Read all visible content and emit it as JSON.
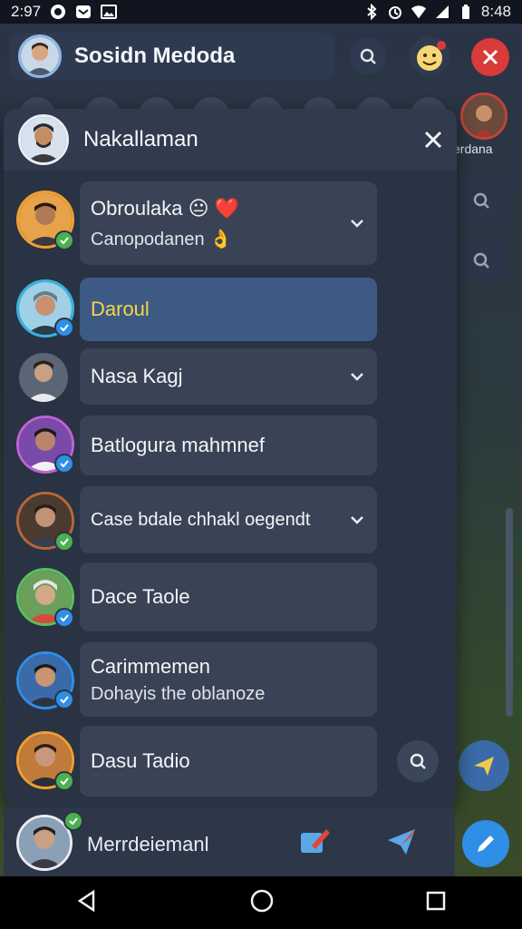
{
  "status_bar": {
    "time_left": "2:97",
    "time_right": "8:48"
  },
  "app_header": {
    "title": "Sosidn Medoda"
  },
  "story_row": {
    "side_label": "erdana"
  },
  "panel": {
    "title": "Nakallaman",
    "contacts": [
      {
        "name": "Obroulaka 😐 ❤️",
        "subtitle": "Canopodanen 👌",
        "badge": "green",
        "expand": true
      },
      {
        "name": "Daroul",
        "subtitle": "",
        "badge": "blue",
        "selected": true
      },
      {
        "name": "Nasa Kagj",
        "subtitle": "",
        "badge": "",
        "expand": true
      },
      {
        "name": "Batlogura mahmnef",
        "subtitle": "",
        "badge": "blue"
      },
      {
        "name": "Case bdale chhakl oegendt",
        "subtitle": "",
        "badge": "green",
        "expand": true
      },
      {
        "name": "Dace Taole",
        "subtitle": "",
        "badge": "blue"
      },
      {
        "name": "Carimmemen",
        "subtitle": "Dohayis the oblanoze",
        "badge": "blue"
      },
      {
        "name": "Dasu Tadio",
        "subtitle": "",
        "badge": "green"
      }
    ]
  },
  "bottom_bar": {
    "name": "Merrdeiemanl"
  },
  "colors": {
    "accent_blue": "#2f8fe6",
    "close_red": "#d93a3a",
    "selected_row": "#3d5a85",
    "selected_text": "#f5d547",
    "badge_green": "#4caf50"
  }
}
